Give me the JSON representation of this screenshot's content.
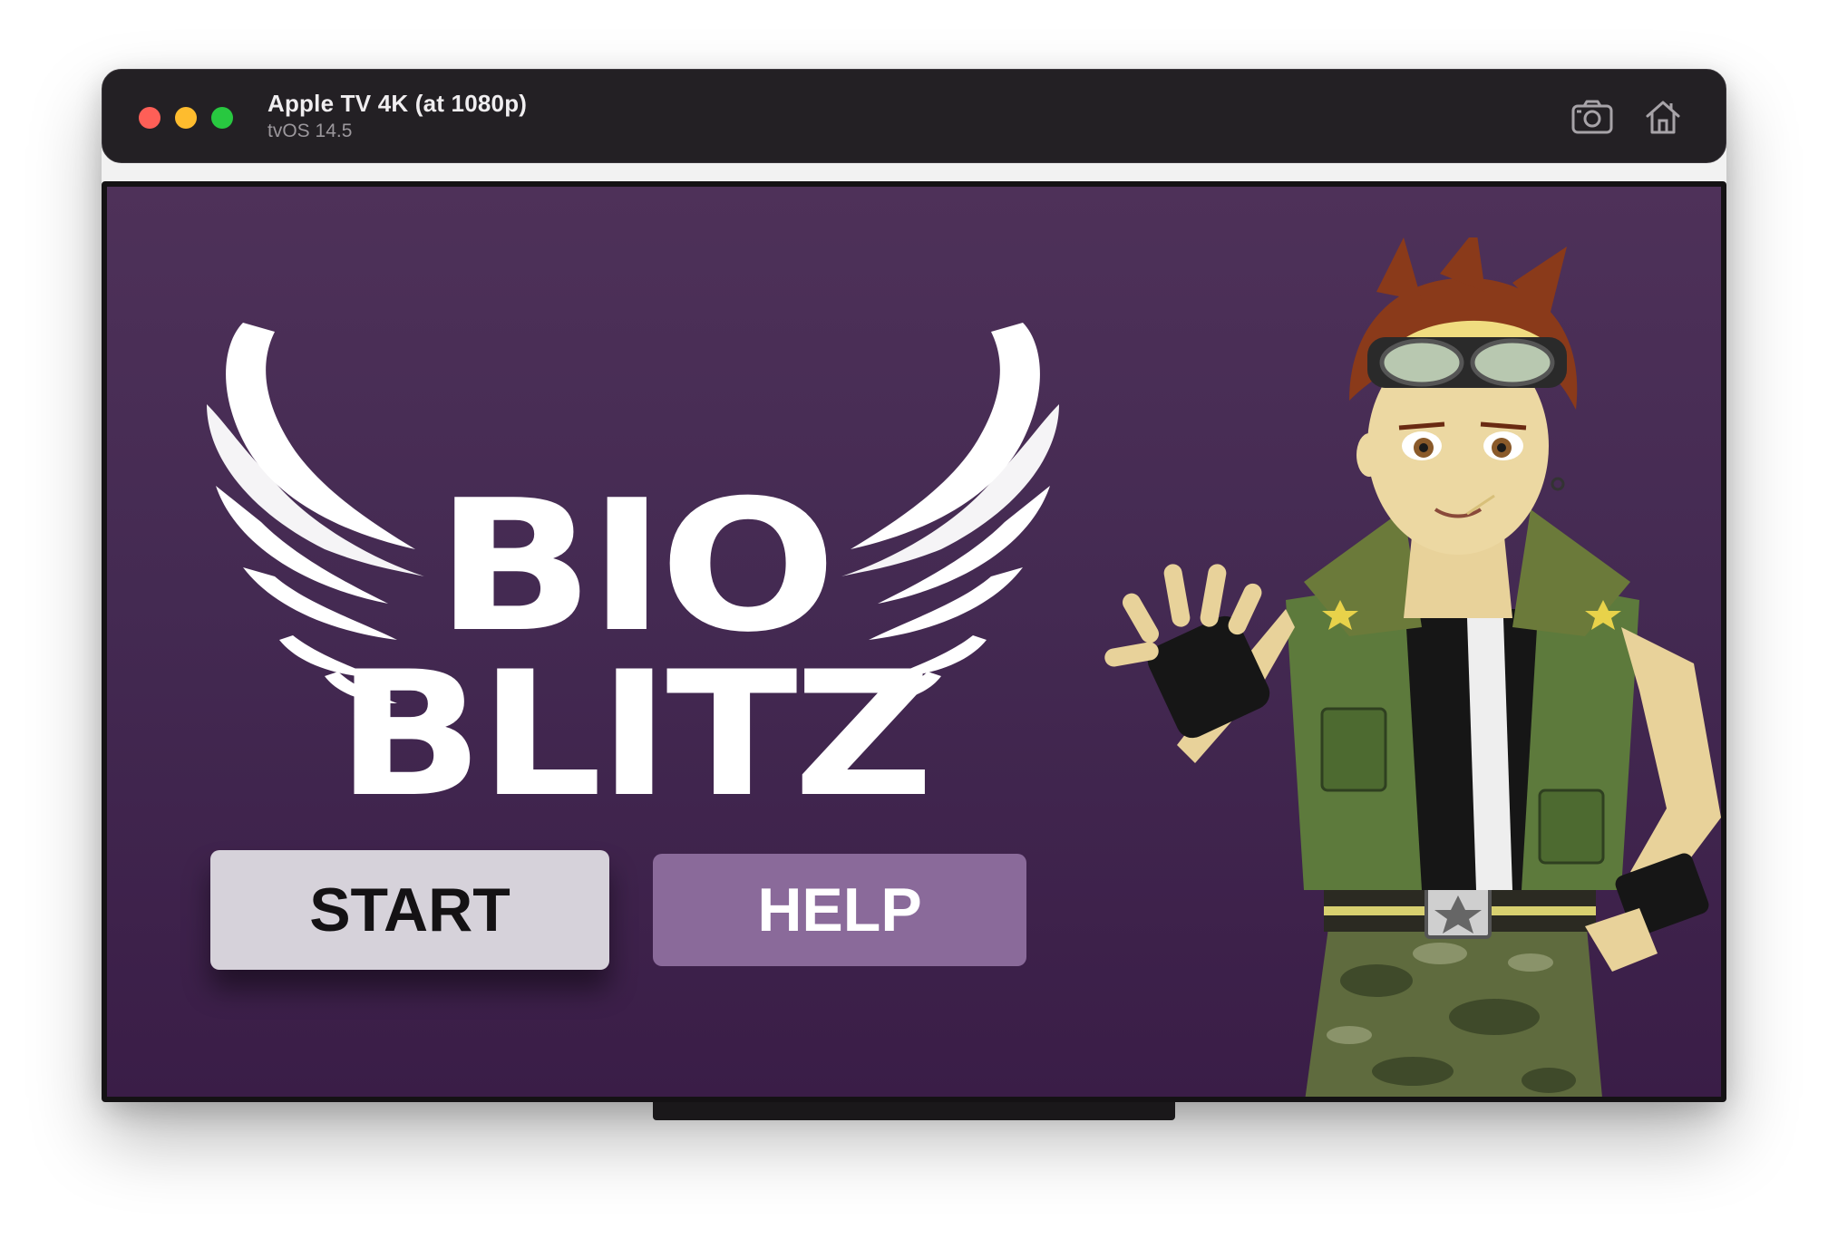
{
  "window": {
    "title": "Apple TV 4K (at 1080p)",
    "subtitle": "tvOS 14.5",
    "controls": [
      "close",
      "minimize",
      "zoom"
    ],
    "toolbar_icons": [
      "screenshot-icon",
      "home-icon"
    ]
  },
  "game": {
    "logo_line1": "BIO",
    "logo_line2": "BLITZ",
    "buttons": {
      "start_label": "START",
      "help_label": "HELP"
    },
    "focused_button": "START"
  },
  "colors": {
    "titlebar": "#232024",
    "screen_top": "#4e3159",
    "screen_bottom": "#3a1d47",
    "start_button": "#d6d2da",
    "help_button": "#8a6a9a"
  }
}
